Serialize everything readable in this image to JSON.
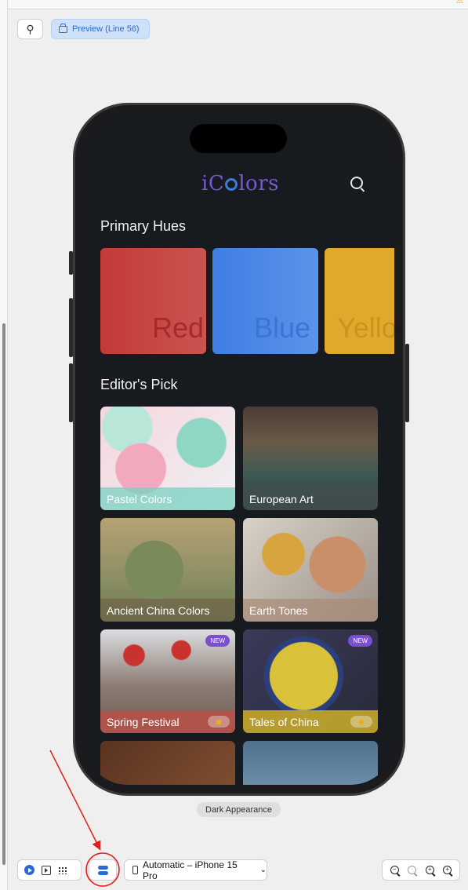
{
  "toolbar": {
    "pin_icon": "pin-icon",
    "preview_label": "Preview (Line 56)"
  },
  "app": {
    "logo_prefix": "iC",
    "logo_suffix": "lors",
    "sections": {
      "primary": "Primary Hues",
      "editors": "Editor's Pick"
    },
    "hues": [
      {
        "name": "Red",
        "color": "#c43a37"
      },
      {
        "name": "Blue",
        "color": "#3f7ee4"
      },
      {
        "name": "Yello",
        "color": "#e1a92c"
      }
    ],
    "cards": [
      {
        "label": "Pastel Colors"
      },
      {
        "label": "European Art"
      },
      {
        "label": "Ancient China Colors"
      },
      {
        "label": "Earth Tones"
      },
      {
        "label": "Spring Festival",
        "badge": "NEW"
      },
      {
        "label": "Tales of China",
        "badge": "NEW"
      }
    ]
  },
  "appearance_label": "Dark Appearance",
  "bottom_bar": {
    "device": "Automatic – iPhone 15 Pro"
  },
  "colors": {
    "accent": "#2a6ad8",
    "annotation": "#e0201c"
  }
}
